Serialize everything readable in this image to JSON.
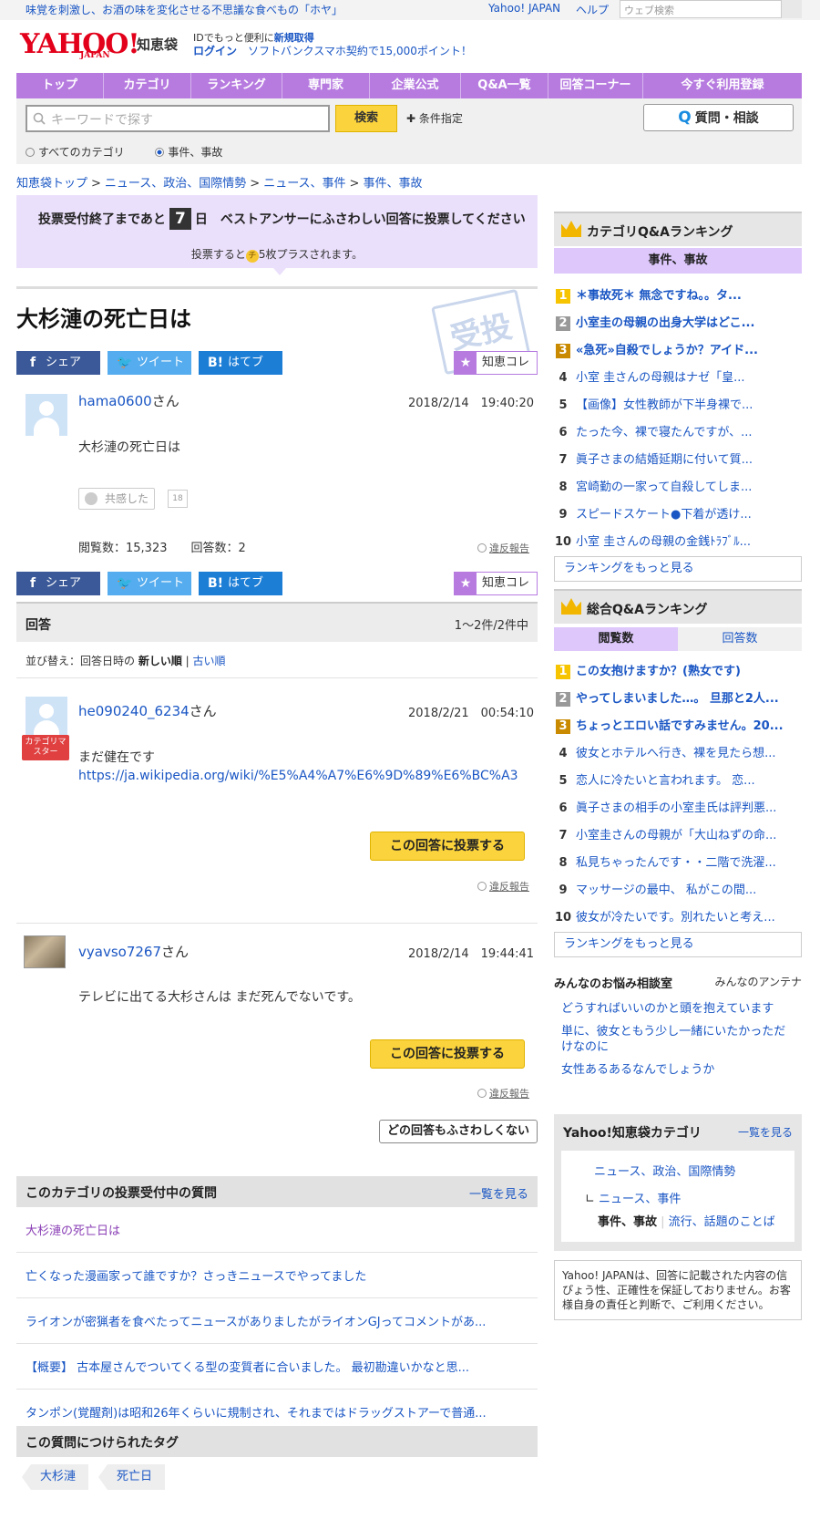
{
  "topbar": {
    "promo": "味覚を刺激し、お酒の味を変化させる不思議な食べもの「ホヤ」",
    "yahoo_japan": "Yahoo! JAPAN",
    "help": "ヘルプ",
    "web_search_placeholder": "ウェブ検索"
  },
  "header": {
    "logo": "YAHOO!",
    "logo_sub": "JAPAN",
    "service": "知恵袋",
    "id_text": "IDでもっと便利に",
    "id_link": "新規取得",
    "login": "ログイン",
    "promo2": "ソフトバンクスマホ契約で15,000ポイント！"
  },
  "nav": [
    "トップ",
    "カテゴリ",
    "ランキング",
    "専門家",
    "企業公式",
    "Q&A一覧",
    "回答コーナー",
    "今すぐ利用登録"
  ],
  "search": {
    "placeholder": "キーワードで探す",
    "button": "検索",
    "conditions": "条件指定",
    "ask_button": "質問・相談",
    "scope_all": "すべてのカテゴリ",
    "scope_current": "事件、事故"
  },
  "breadcrumb": [
    "知恵袋トップ",
    "ニュース、政治、国際情勢",
    "ニュース、事件",
    "事件、事故"
  ],
  "vote_banner": {
    "prefix": "投票受付終了まであと",
    "days": "7",
    "suffix": "日　ベストアンサーにふさわしい回答に投票してください",
    "sub_prefix": "投票すると",
    "coin": "チ",
    "sub_suffix": "5枚プラスされます。"
  },
  "question": {
    "title": "大杉漣の死亡日は",
    "stamp": "受投",
    "user": "hama0600",
    "san": "さん",
    "date": "2018/2/14　19:40:20",
    "body": "大杉漣の死亡日は",
    "empathy_label": "共感した",
    "empathy_count": "18",
    "views": "閲覧数：15,323",
    "answers": "回答数：2",
    "report": "違反報告"
  },
  "share": {
    "facebook": "シェア",
    "twitter": "ツイート",
    "hatena": "はてブ",
    "chiekore": "知恵コレ"
  },
  "answers_section": {
    "title": "回答",
    "count": "1〜2件/2件中",
    "sort_label": "並び替え：回答日時の",
    "sort_new": "新しい順",
    "sort_old": "古い順"
  },
  "answers": [
    {
      "user": "he090240_6234",
      "san": "さん",
      "date": "2018/2/21　00:54:10",
      "badge": "カテゴリマスター",
      "body": "まだ健在です",
      "link": "https://ja.wikipedia.org/wiki/%E5%A4%A7%E6%9D%89%E6%BC%A3",
      "vote": "この回答に投票する",
      "report": "違反報告"
    },
    {
      "user": "vyavso7267",
      "san": "さん",
      "date": "2018/2/14　19:44:41",
      "body": "テレビに出てる大杉さんは まだ死んでないです。",
      "vote": "この回答に投票する",
      "report": "違反報告"
    }
  ],
  "none_button": "どの回答もふさわしくない",
  "voting_questions": {
    "title": "このカテゴリの投票受付中の質問",
    "more": "一覧を見る",
    "items": [
      "大杉漣の死亡日は",
      "亡くなった漫画家って誰ですか？さっきニュースでやってました",
      "ライオンが密猟者を食べたってニュースがありましたがライオンGJってコメントがあ...",
      "【概要】 古本屋さんでついてくる型の変質者に合いました。 最初勘違いかなと思...",
      "タンポン(覚醒剤)は昭和26年くらいに規制され、それまではドラッグストアーで普通..."
    ]
  },
  "tags": {
    "title": "この質問につけられたタグ",
    "items": [
      "大杉漣",
      "死亡日"
    ]
  },
  "category_ranking": {
    "title": "カテゴリQ&Aランキング",
    "subtitle": "事件、事故",
    "items": [
      "＊事故死＊ 無念ですね。。タ...",
      "小室圭の母親の出身大学はどこ...",
      "«急死»自殺でしょうか？アイド...",
      "小室 圭さんの母親はナゼ「皇...",
      "【画像】女性教師が下半身裸で...",
      "たった今、裸で寝たんですが、...",
      "眞子さまの結婚延期に付いて質...",
      "宮崎勤の一家って自殺してしま...",
      "スピードスケート●下着が透け...",
      "小室 圭さんの母親の金銭ﾄﾗﾌﾞﾙ..."
    ],
    "more": "ランキングをもっと見る"
  },
  "total_ranking": {
    "title": "総合Q&Aランキング",
    "tab_views": "閲覧数",
    "tab_answers": "回答数",
    "items": [
      "この女抱けますか？(熟女です)",
      "やってしまいました…。 旦那と2人...",
      "ちょっとエロい話ですみません。20...",
      "彼女とホテルへ行き、裸を見たら想...",
      "恋人に冷たいと言われます。 恋...",
      "眞子さまの相手の小室圭氏は評判悪...",
      "小室圭さんの母親が「大山ねずの命...",
      "私見ちゃったんです・・二階で洗濯...",
      "マッサージの最中、 私がこの間...",
      "彼女が冷たいです。別れたいと考え..."
    ],
    "more": "ランキングをもっと見る"
  },
  "consult": {
    "title": "みんなのお悩み相談室",
    "antenna": "みんなのアンテナ",
    "items": [
      "どうすればいいのかと頭を抱えています",
      "単に、彼女ともう少し一緒にいたかっただけなのに",
      "女性あるあるなんでしょうか"
    ]
  },
  "category_box": {
    "title": "Yahoo!知恵袋カテゴリ",
    "more": "一覧を見る",
    "l1": "ニュース、政治、国際情勢",
    "l2": "ニュース、事件",
    "current": "事件、事故",
    "sibling": "流行、話題のことば"
  },
  "disclaimer": "Yahoo! JAPANは、回答に記載された内容の信ぴょう性、正確性を保証しておりません。お客様自身の責任と判断で、ご利用ください。"
}
